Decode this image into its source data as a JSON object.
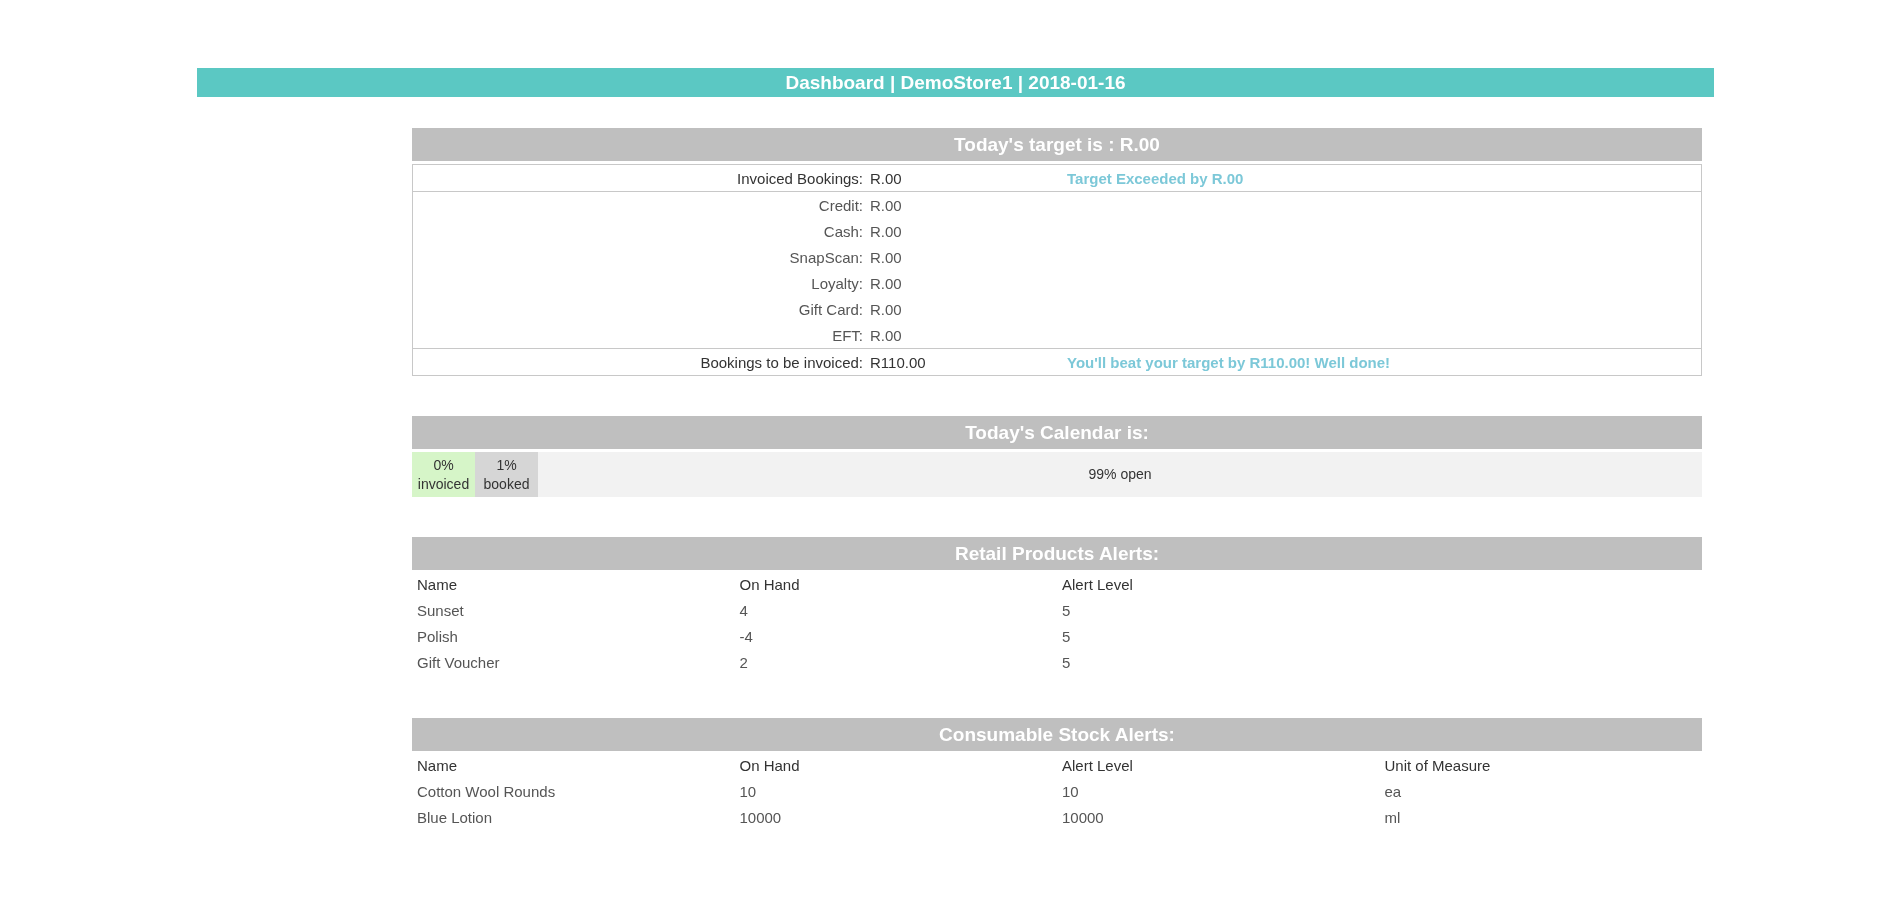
{
  "header": {
    "title": "Dashboard | DemoStore1 | 2018-01-16"
  },
  "target": {
    "title": "Today's target is : R.00",
    "invoiced": {
      "label": "Invoiced Bookings:",
      "value": "R.00",
      "message": "Target Exceeded by R.00"
    },
    "payments": [
      {
        "label": "Credit:",
        "value": "R.00"
      },
      {
        "label": "Cash:",
        "value": "R.00"
      },
      {
        "label": "SnapScan:",
        "value": "R.00"
      },
      {
        "label": "Loyalty:",
        "value": "R.00"
      },
      {
        "label": "Gift Card:",
        "value": "R.00"
      },
      {
        "label": "EFT:",
        "value": "R.00"
      }
    ],
    "to_invoice": {
      "label": "Bookings to be invoiced:",
      "value": "R110.00",
      "message": "You'll beat your target by R110.00! Well done!"
    }
  },
  "calendar": {
    "title": "Today's Calendar is:",
    "segments": [
      {
        "text": "0% invoiced",
        "color": "#d6f5c8"
      },
      {
        "text": "1% booked",
        "color": "#d6d6d6"
      },
      {
        "text": "99% open",
        "color": "#f2f2f2"
      }
    ]
  },
  "retail_alerts": {
    "title": "Retail Products Alerts:",
    "columns": [
      "Name",
      "On Hand",
      "Alert Level"
    ],
    "rows": [
      [
        "Sunset",
        "4",
        "5"
      ],
      [
        "Polish",
        "-4",
        "5"
      ],
      [
        "Gift Voucher",
        "2",
        "5"
      ]
    ]
  },
  "consumable_alerts": {
    "title": "Consumable Stock Alerts:",
    "columns": [
      "Name",
      "On Hand",
      "Alert Level",
      "Unit of Measure"
    ],
    "rows": [
      [
        "Cotton Wool Rounds",
        "10",
        "10",
        "ea"
      ],
      [
        "Blue Lotion",
        "10000",
        "10000",
        "ml"
      ]
    ]
  }
}
